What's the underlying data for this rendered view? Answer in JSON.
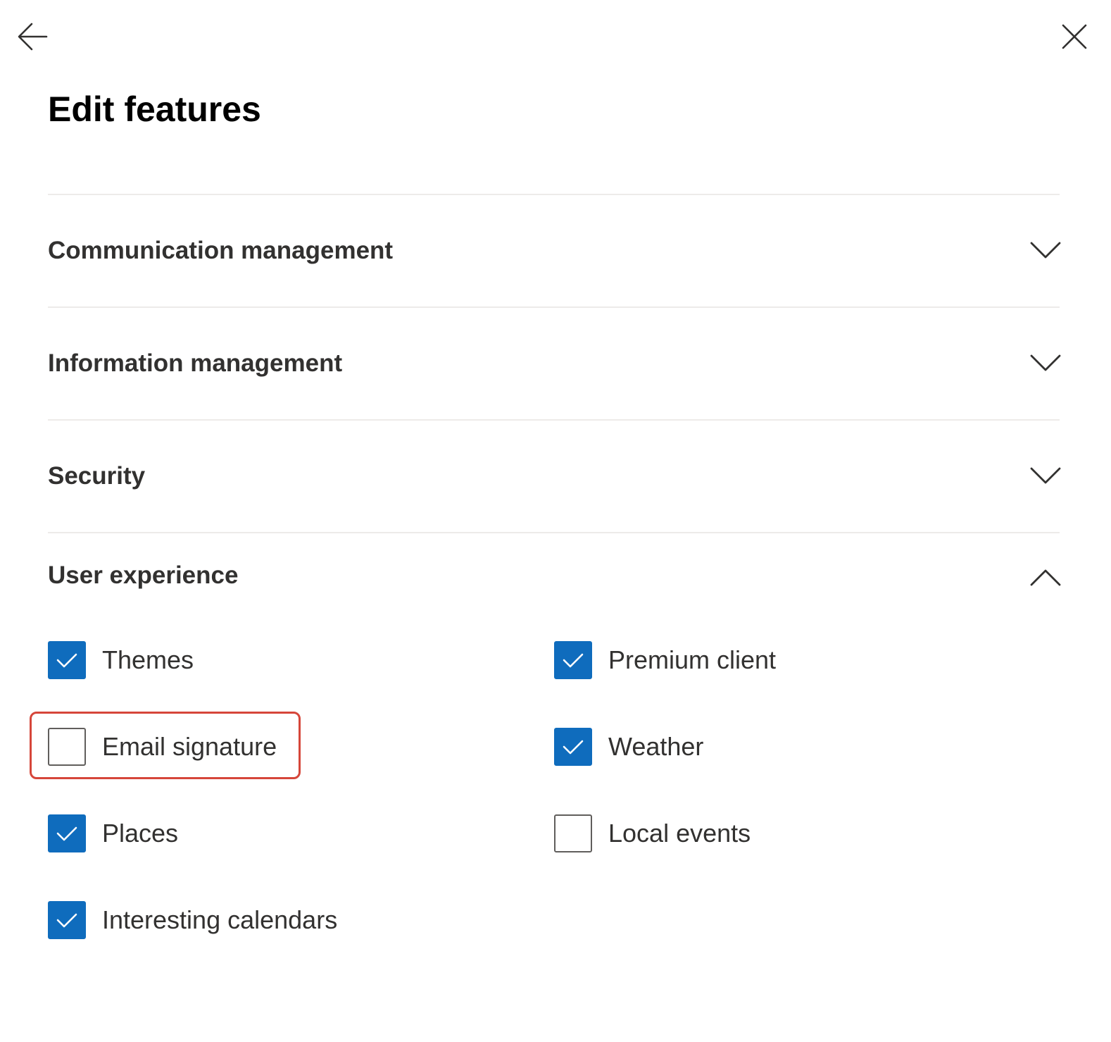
{
  "header": {
    "back_icon": "arrow-left-icon",
    "close_icon": "close-icon",
    "title": "Edit features"
  },
  "sections": [
    {
      "title": "Communication management",
      "expanded": false,
      "chevron_icon": "chevron-down-icon"
    },
    {
      "title": "Information management",
      "expanded": false,
      "chevron_icon": "chevron-down-icon"
    },
    {
      "title": "Security",
      "expanded": false,
      "chevron_icon": "chevron-down-icon"
    },
    {
      "title": "User experience",
      "expanded": true,
      "chevron_icon": "chevron-up-icon"
    }
  ],
  "user_experience": {
    "options": [
      {
        "label": "Themes",
        "checked": true
      },
      {
        "label": "Premium client",
        "checked": true
      },
      {
        "label": "Email signature",
        "checked": false,
        "highlighted": true
      },
      {
        "label": "Weather",
        "checked": true
      },
      {
        "label": "Places",
        "checked": true
      },
      {
        "label": "Local events",
        "checked": false
      },
      {
        "label": "Interesting calendars",
        "checked": true
      }
    ]
  },
  "colors": {
    "checkbox_checked": "#0f6cbd",
    "highlight_border": "#d6463a",
    "divider": "#edebe9"
  }
}
